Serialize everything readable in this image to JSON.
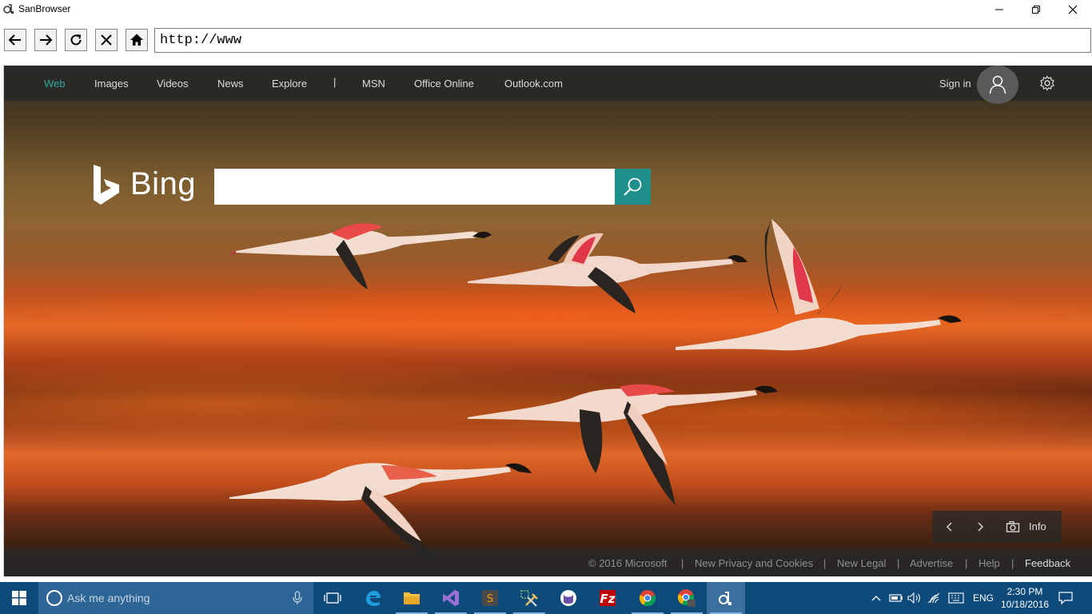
{
  "window": {
    "title": "SanBrowser"
  },
  "toolbar": {
    "url": "http://www"
  },
  "nav": {
    "items": [
      "Web",
      "Images",
      "Videos",
      "News",
      "Explore",
      "MSN",
      "Office Online",
      "Outlook.com"
    ],
    "separator": "|",
    "signin": "Sign in",
    "active_color": "#2ea6a3"
  },
  "search": {
    "logo_text": "Bing",
    "placeholder": "",
    "button_color": "#1f8f8b"
  },
  "carousel": {
    "info_label": "Info"
  },
  "footer": {
    "copyright": "© 2016 Microsoft",
    "links": [
      "New Privacy and Cookies",
      "New Legal",
      "Advertise",
      "Help",
      "Feedback"
    ],
    "separator": "|"
  },
  "taskbar": {
    "search_text": "Ask me anything",
    "apps": [
      "task-view",
      "edge",
      "file-explorer",
      "visual-studio",
      "sublime-text",
      "tools",
      "cat-app",
      "filezilla",
      "chrome",
      "chrome-user",
      "sanbrowser"
    ],
    "language": "ENG",
    "time": "2:30 PM",
    "date": "10/18/2016"
  }
}
